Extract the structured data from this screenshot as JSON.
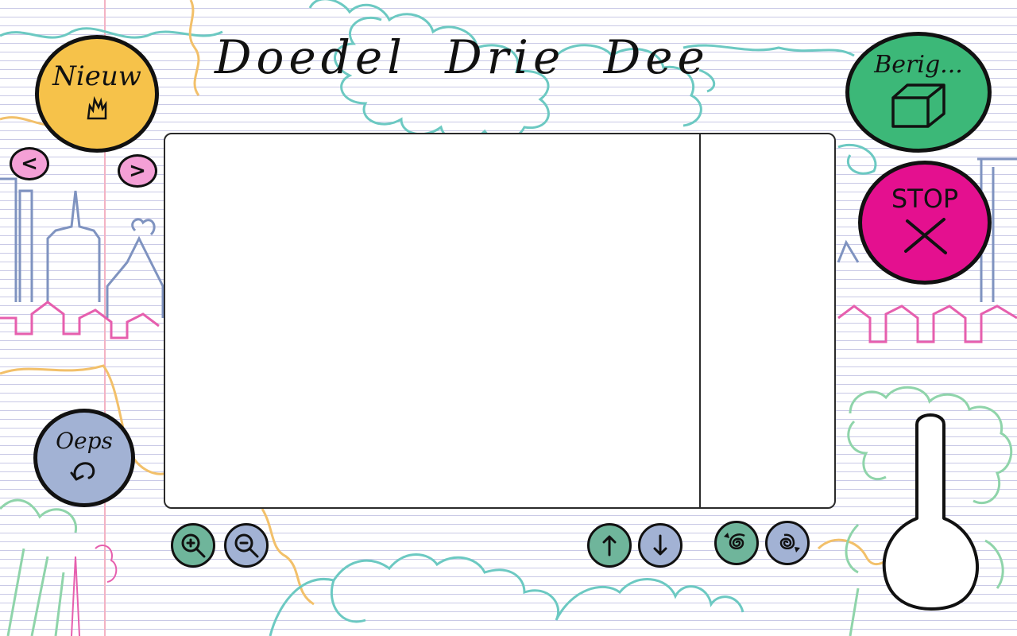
{
  "app": {
    "title": "Doedel Drie Dee"
  },
  "buttons": {
    "new": {
      "label": "Nieuw",
      "icon": "fire-icon",
      "color": "#f6c24a"
    },
    "save": {
      "label": "Berig...",
      "icon": "box-icon",
      "color": "#3cb878"
    },
    "stop": {
      "label": "STOP",
      "icon": "x-icon",
      "color": "#e4108f"
    },
    "undo": {
      "label": "Oeps",
      "icon": "undo-icon",
      "color": "#a2b2d4"
    },
    "prev": {
      "label": "<",
      "icon": "chevron-left-icon",
      "color": "#f4a0d6"
    },
    "next": {
      "label": ">",
      "icon": "chevron-right-icon",
      "color": "#f4a0d6"
    }
  },
  "toolbar": {
    "zoom_in": {
      "icon": "zoom-in-icon",
      "color": "#6fb59b"
    },
    "zoom_out": {
      "icon": "zoom-out-icon",
      "color": "#a2b2d4"
    },
    "move_up": {
      "icon": "arrow-up-icon",
      "color": "#6fb59b"
    },
    "move_down": {
      "icon": "arrow-down-icon",
      "color": "#a2b2d4"
    },
    "rotate_left": {
      "icon": "spiral-left-icon",
      "color": "#6fb59b"
    },
    "rotate_right": {
      "icon": "spiral-right-icon",
      "color": "#a2b2d4"
    }
  },
  "colors": {
    "paper_line": "#c9c9e6",
    "doodle_teal": "#6cc9c2",
    "doodle_blue": "#7f93c0",
    "doodle_pink": "#e65fae",
    "doodle_yellow": "#f2c06a",
    "doodle_green": "#8fd4aa"
  }
}
